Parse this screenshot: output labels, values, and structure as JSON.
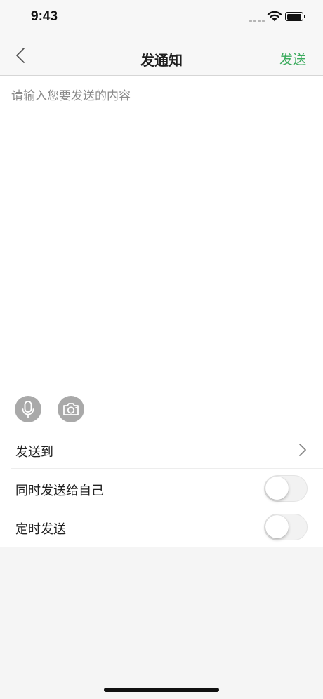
{
  "status_bar": {
    "time": "9:43"
  },
  "nav": {
    "title": "发通知",
    "send_label": "发送"
  },
  "composer": {
    "placeholder": "请输入您要发送的内容",
    "value": ""
  },
  "options": {
    "send_to_label": "发送到",
    "send_to_self_label": "同时发送给自己",
    "send_to_self_on": false,
    "scheduled_label": "定时发送",
    "scheduled_on": false
  },
  "icons": [
    "back-chevron-icon",
    "microphone-icon",
    "camera-icon",
    "chevron-right-icon",
    "wifi-icon",
    "battery-icon",
    "signal-icon"
  ],
  "colors": {
    "accent": "#3bab5d",
    "tool_icon_bg": "#a9a9a9",
    "background": "#f5f5f5"
  }
}
